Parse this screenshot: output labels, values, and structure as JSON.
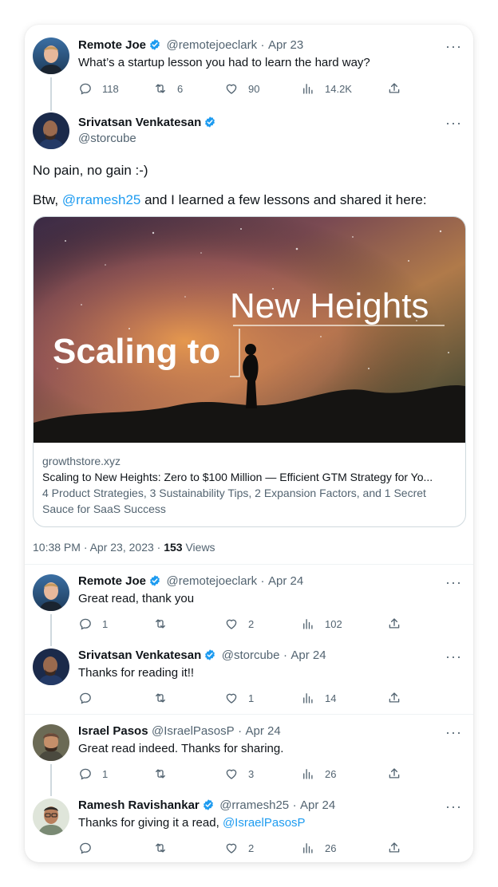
{
  "tweets": [
    {
      "name": "Remote Joe",
      "handle": "@remotejoeclark",
      "sep": "·",
      "date": "Apr 23",
      "text": "What’s a startup lesson you had to learn the hard way?",
      "replies": "118",
      "retweets": "6",
      "likes": "90",
      "views": "14.2K"
    }
  ],
  "main": {
    "name": "Srivatsan Venkatesan",
    "handle": "@storcube",
    "line1": "No pain, no gain :-)",
    "line2_prefix": "Btw, ",
    "line2_mention": "@rramesh25",
    "line2_suffix": " and I learned a few lessons and shared it here:",
    "card": {
      "image_text_1": "New Heights",
      "image_text_2": "Scaling to",
      "domain": "growthstore.xyz",
      "title": "Scaling to New Heights: Zero to $100 Million — Efficient GTM Strategy for Yo...",
      "description": "4 Product Strategies, 3 Sustainability Tips, 2 Expansion Factors, and 1 Secret Sauce for SaaS Success"
    },
    "time": "10:38 PM · Apr 23, 2023 · ",
    "views": "153",
    "views_label": " Views"
  },
  "replies": [
    {
      "name": "Remote Joe",
      "handle": "@remotejoeclark",
      "sep": "·",
      "date": "Apr 24",
      "text": "Great read, thank you",
      "replies": "1",
      "retweets": "",
      "likes": "2",
      "views": "102"
    },
    {
      "name": "Srivatsan Venkatesan",
      "handle": "@storcube",
      "sep": "·",
      "date": "Apr 24",
      "text": "Thanks for reading it!!",
      "replies": "",
      "retweets": "",
      "likes": "1",
      "views": "14"
    },
    {
      "name": "Israel Pasos",
      "handle": "@IsraelPasosP",
      "sep": "·",
      "date": "Apr 24",
      "text": "Great read indeed. Thanks for sharing.",
      "replies": "1",
      "retweets": "",
      "likes": "3",
      "views": "26"
    },
    {
      "name": "Ramesh Ravishankar",
      "handle": "@rramesh25",
      "sep": "·",
      "date": "Apr 24",
      "text_prefix": "Thanks for giving it a read, ",
      "text_mention": "@IsraelPasosP",
      "replies": "",
      "retweets": "",
      "likes": "2",
      "views": "26"
    }
  ],
  "more_label": "···",
  "colors": {
    "accent": "#1d9bf0",
    "muted": "#536471",
    "text": "#0f1419",
    "border": "#cfd9de"
  },
  "icons": [
    "reply-icon",
    "retweet-icon",
    "like-icon",
    "views-icon",
    "share-icon",
    "verified-badge-icon",
    "more-icon"
  ]
}
